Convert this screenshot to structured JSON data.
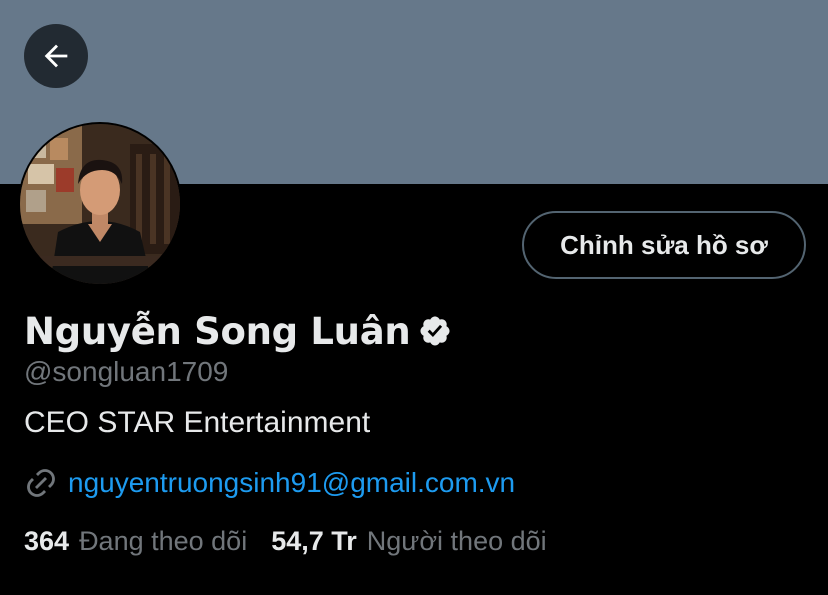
{
  "profile": {
    "name": "Nguyễn Song Luân",
    "handle": "@songluan1709",
    "bio": "CEO STAR Entertainment",
    "link": "nguyentruongsinh91@gmail.com.vn",
    "verified": true
  },
  "actions": {
    "edit_profile_label": "Chỉnh sửa hồ sơ"
  },
  "stats": {
    "following": {
      "count": "364",
      "label": "Đang theo dõi"
    },
    "followers": {
      "count": "54,7 Tr",
      "label": "Người theo dõi"
    }
  },
  "icons": {
    "back": "arrow-left-icon",
    "verified": "verified-badge-icon",
    "link": "link-icon"
  },
  "colors": {
    "banner": "#66788a",
    "background": "#000000",
    "link": "#1d9bf0",
    "secondary_text": "#71767b",
    "button_border": "#536471"
  }
}
